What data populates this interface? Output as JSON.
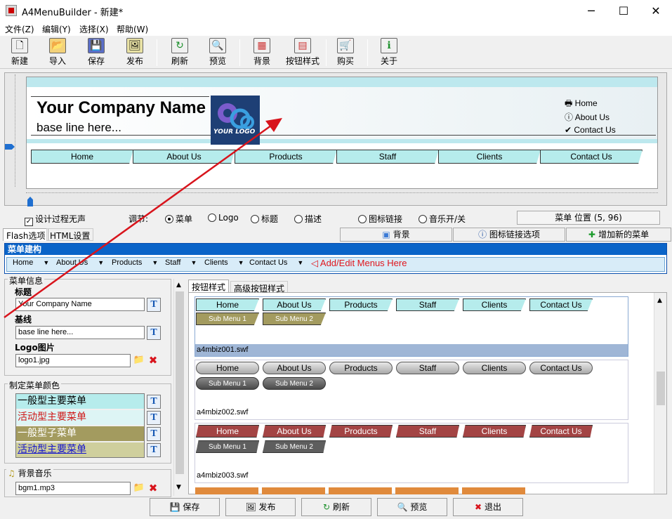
{
  "window": {
    "title": "A4MenuBuilder - 新建*",
    "controls": {
      "minimize": "─",
      "maximize": "☐",
      "close": "✕"
    }
  },
  "menubar": [
    "文件(Z)",
    "编辑(Y)",
    "选择(X)",
    "帮助(W)"
  ],
  "toolbar": [
    {
      "label": "新建",
      "icon": "new-file-icon",
      "glyph": "🗋"
    },
    {
      "label": "导入",
      "icon": "folder-open-icon",
      "glyph": "📂"
    },
    {
      "label": "保存",
      "icon": "save-icon",
      "glyph": "💾"
    },
    {
      "label": "发布",
      "icon": "publish-icon",
      "glyph": "🖼"
    },
    {
      "label": "刷新",
      "icon": "refresh-icon",
      "glyph": "↻"
    },
    {
      "label": "预览",
      "icon": "preview-icon",
      "glyph": "🔍"
    },
    {
      "label": "背景",
      "icon": "background-icon",
      "glyph": "▦"
    },
    {
      "label": "按钮样式",
      "icon": "button-style-icon",
      "glyph": "▤"
    },
    {
      "label": "购买",
      "icon": "cart-icon",
      "glyph": "🛒"
    },
    {
      "label": "关于",
      "icon": "info-icon",
      "glyph": "ℹ"
    }
  ],
  "preview": {
    "company_name": "Your Company Name",
    "base_line": "base line here...",
    "logo_text": "YOUR LOGO",
    "top_links": [
      "Home",
      "About Us",
      "Contact Us"
    ],
    "menu": [
      "Home",
      "About Us",
      "Products",
      "Staff",
      "Clients",
      "Contact Us"
    ]
  },
  "options": {
    "silent_design": "设计过程无声",
    "adjust_label": "调节:",
    "radios": [
      "菜单",
      "Logo",
      "标题",
      "描述",
      "图标链接",
      "音乐开/关"
    ],
    "selected_radio": "菜单",
    "position_status": "菜单 位置 (5, 96)"
  },
  "tabs": {
    "left": [
      "Flash选项",
      "HTML设置"
    ],
    "buttons": [
      "背景",
      "图标链接选项",
      "增加新的菜单"
    ]
  },
  "menu_structure": {
    "title": "菜单建构",
    "items": [
      "Home",
      "About Us",
      "Products",
      "Staff",
      "Clients",
      "Contact Us"
    ],
    "add_edit": "Add/Edit Menus Here"
  },
  "menu_info": {
    "group_title": "菜单信息",
    "title_label": "标题",
    "title_value": "Your Company Name",
    "baseline_label": "基线",
    "baseline_value": "base line here...",
    "logo_label": "Logo图片",
    "logo_value": "logo1.jpg"
  },
  "menu_colors": {
    "group_title": "制定菜单颜色",
    "rows": [
      {
        "label": "一般型主要菜单",
        "bg": "#b6ecec",
        "fg": "#000000"
      },
      {
        "label": "活动型主要菜单",
        "bg": "#ddf5f5",
        "fg": "#d01818"
      },
      {
        "label": "一般型子菜单",
        "bg": "#a39b5f",
        "fg": "#ffffff"
      },
      {
        "label": "活动型主要菜单",
        "bg": "#cfcf9d",
        "fg": "#1616cc"
      }
    ]
  },
  "bg_music": {
    "group_title": "背景音乐",
    "value": "bgm1.mp3"
  },
  "style_tabs": [
    "按钮样式",
    "高级按钮样式"
  ],
  "styles": [
    {
      "file": "a4mbiz001.swf",
      "main_bg": "#b6ecec",
      "main_fg": "#000000",
      "sub_bg": "#a39b5f",
      "sub_fg": "#ffffff",
      "selected": true,
      "menu": [
        "Home",
        "About Us",
        "Products",
        "Staff",
        "Clients",
        "Contact Us"
      ],
      "subs": [
        "Sub Menu 1",
        "Sub Menu 2"
      ]
    },
    {
      "file": "a4mbiz002.swf",
      "main_bg": "#c4c4c4",
      "main_fg": "#000000",
      "sub_bg": "#6a6a6a",
      "sub_fg": "#ffffff",
      "selected": false,
      "menu": [
        "Home",
        "About Us",
        "Products",
        "Staff",
        "Clients",
        "Contact Us"
      ],
      "subs": [
        "Sub Menu 1",
        "Sub Menu 2"
      ]
    },
    {
      "file": "a4mbiz003.swf",
      "main_bg": "#a34444",
      "main_fg": "#ffffff",
      "sub_bg": "#5e5e5e",
      "sub_fg": "#ffffff",
      "selected": false,
      "menu": [
        "Home",
        "About Us",
        "Products",
        "Staff",
        "Clients",
        "Contact Us"
      ],
      "subs": [
        "Sub Menu 1",
        "Sub Menu 2"
      ]
    }
  ],
  "bottom_buttons": [
    {
      "label": "保存",
      "icon": "save-icon",
      "glyph": "💾"
    },
    {
      "label": "发布",
      "icon": "publish-icon",
      "glyph": "🖼"
    },
    {
      "label": "刷新",
      "icon": "refresh-icon",
      "glyph": "↻"
    },
    {
      "label": "预览",
      "icon": "preview-icon",
      "glyph": "🔍"
    },
    {
      "label": "退出",
      "icon": "exit-icon",
      "glyph": "✖"
    }
  ],
  "colors": {
    "accent_blue": "#0a64c8",
    "arrow_red": "#d8141c"
  }
}
